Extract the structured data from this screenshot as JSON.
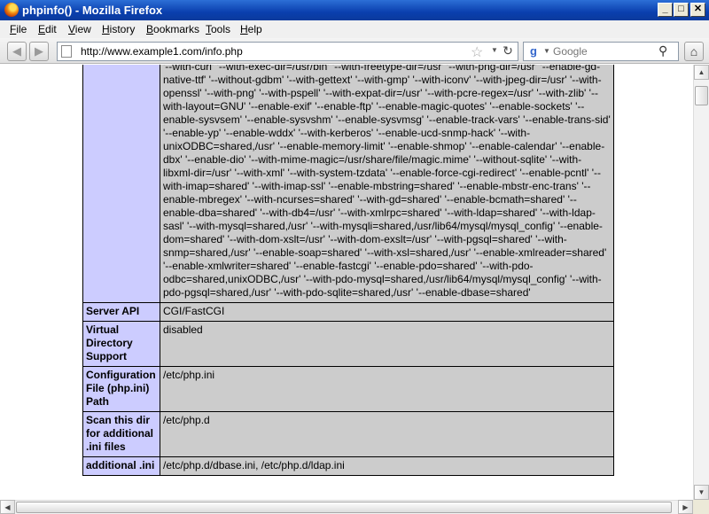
{
  "window": {
    "title": "phpinfo() - Mozilla Firefox",
    "minimize_glyph": "_",
    "maximize_glyph": "□",
    "close_glyph": "✕"
  },
  "menu": [
    "File",
    "Edit",
    "View",
    "History",
    "Bookmarks",
    "Tools",
    "Help"
  ],
  "menu_accel": [
    "F",
    "E",
    "V",
    "H",
    "B",
    "T",
    "H"
  ],
  "nav": {
    "back_glyph": "◀",
    "forward_glyph": "▶",
    "url": "http://www.example1.com/info.php",
    "star_glyph": "☆",
    "reload_glyph": "↻",
    "search_engine_glyph": "g",
    "search_placeholder": "Google",
    "search_icon_glyph": "⚲",
    "home_glyph": "⌂"
  },
  "rows": [
    {
      "key": "",
      "value": "'--with-curl' '--with-exec-dir=/usr/bin' '--with-freetype-dir=/usr' '--with-png-dir=/usr' '--enable-gd-native-ttf' '--without-gdbm' '--with-gettext' '--with-gmp' '--with-iconv' '--with-jpeg-dir=/usr' '--with-openssl' '--with-png' '--with-pspell' '--with-expat-dir=/usr' '--with-pcre-regex=/usr' '--with-zlib' '--with-layout=GNU' '--enable-exif' '--enable-ftp' '--enable-magic-quotes' '--enable-sockets' '--enable-sysvsem' '--enable-sysvshm' '--enable-sysvmsg' '--enable-track-vars' '--enable-trans-sid' '--enable-yp' '--enable-wddx' '--with-kerberos' '--enable-ucd-snmp-hack' '--with-unixODBC=shared,/usr' '--enable-memory-limit' '--enable-shmop' '--enable-calendar' '--enable-dbx' '--enable-dio' '--with-mime-magic=/usr/share/file/magic.mime' '--without-sqlite' '--with-libxml-dir=/usr' '--with-xml' '--with-system-tzdata' '--enable-force-cgi-redirect' '--enable-pcntl' '--with-imap=shared' '--with-imap-ssl' '--enable-mbstring=shared' '--enable-mbstr-enc-trans' '--enable-mbregex' '--with-ncurses=shared' '--with-gd=shared' '--enable-bcmath=shared' '--enable-dba=shared' '--with-db4=/usr' '--with-xmlrpc=shared' '--with-ldap=shared' '--with-ldap-sasl' '--with-mysql=shared,/usr' '--with-mysqli=shared,/usr/lib64/mysql/mysql_config' '--enable-dom=shared' '--with-dom-xslt=/usr' '--with-dom-exslt=/usr' '--with-pgsql=shared' '--with-snmp=shared,/usr' '--enable-soap=shared' '--with-xsl=shared,/usr' '--enable-xmlreader=shared' '--enable-xmlwriter=shared' '--enable-fastcgi' '--enable-pdo=shared' '--with-pdo-odbc=shared,unixODBC,/usr' '--with-pdo-mysql=shared,/usr/lib64/mysql/mysql_config' '--with-pdo-pgsql=shared,/usr' '--with-pdo-sqlite=shared,/usr' '--enable-dbase=shared'"
    },
    {
      "key": "Server API",
      "value": "CGI/FastCGI"
    },
    {
      "key": "Virtual Directory Support",
      "value": "disabled"
    },
    {
      "key": "Configuration File (php.ini) Path",
      "value": "/etc/php.ini"
    },
    {
      "key": "Scan this dir for additional .ini files",
      "value": "/etc/php.d"
    },
    {
      "key": "additional .ini",
      "value": "/etc/php.d/dbase.ini, /etc/php.d/ldap.ini"
    }
  ],
  "scrollbar": {
    "up_glyph": "▲",
    "down_glyph": "▼",
    "left_glyph": "◀",
    "right_glyph": "▶"
  }
}
